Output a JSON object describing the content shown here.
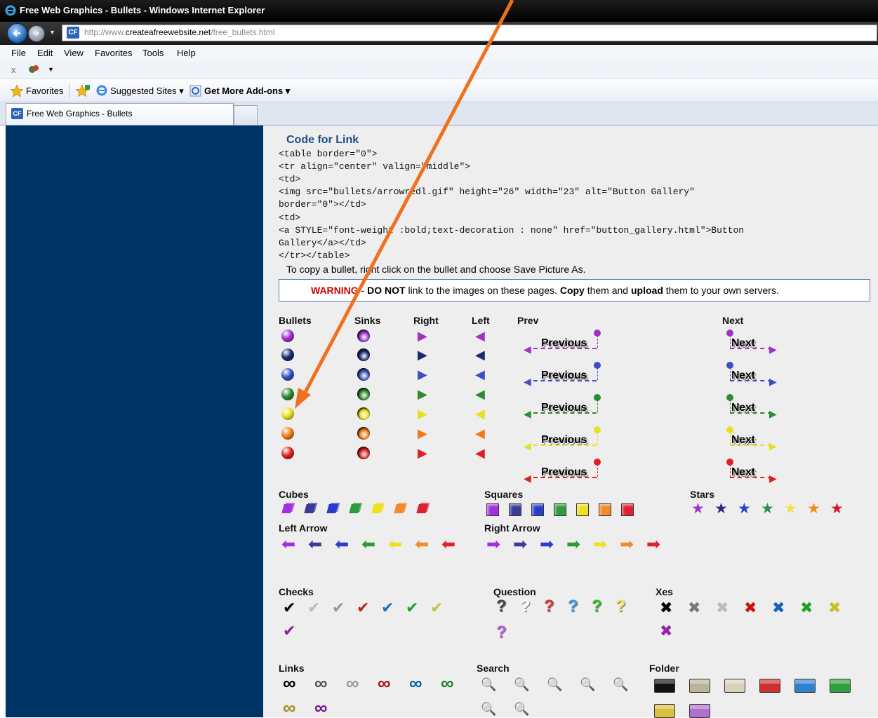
{
  "window": {
    "title": "Free Web Graphics - Bullets - Windows Internet Explorer"
  },
  "address": {
    "prefix": "http://www.",
    "domain": "createafreewebsite.net",
    "path": "/free_bullets.html"
  },
  "menu": [
    "File",
    "Edit",
    "View",
    "Favorites",
    "Tools",
    "Help"
  ],
  "command_bar": {
    "close_glyph": "x"
  },
  "favorites_bar": {
    "favorites": "Favorites",
    "suggested": "Suggested Sites ▾",
    "addons": "Get More Add-ons ▾"
  },
  "tab": {
    "label": "Free Web Graphics - Bullets",
    "icon_text": "CF"
  },
  "page": {
    "code_title": "Code for Link",
    "code_lines": [
      "<table border=\"0\">",
      "<tr align=\"center\" valign=\"middle\">",
      "<td>",
      "<img src=\"bullets/arrowredl.gif\" height=\"26\" width=\"23\" alt=\"Button Gallery\"",
      "border=\"0\"></td>",
      "<td>",
      "<a STYLE=\"font-weight :bold;text-decoration : none\" href=\"button_gallery.html\">Button",
      "Gallery</a></td>",
      "</tr></table>"
    ],
    "copy_note": "To copy a bullet, right click on the bullet and choose Save Picture As.",
    "warning": {
      "label": "WARNING",
      "sep1": " - ",
      "do_not": "DO NOT",
      "mid1": " link to the images on these pages. ",
      "copy": "Copy",
      "mid2": " them and ",
      "upload": "upload",
      "end": " them to your own servers."
    },
    "headers": {
      "bullets": "Bullets",
      "sinks": "Sinks",
      "right": "Right",
      "left": "Left",
      "prev": "Prev",
      "next": "Next",
      "cubes": "Cubes",
      "squares": "Squares",
      "stars": "Stars",
      "left_arrow": "Left Arrow",
      "right_arrow": "Right Arrow",
      "checks": "Checks",
      "question": "Question",
      "xes": "Xes",
      "links": "Links",
      "search": "Search",
      "folder": "Folder"
    },
    "button_labels": {
      "previous": "Previous",
      "next": "Next"
    },
    "glyphs": {
      "right": "▶",
      "left": "◀",
      "star": "★",
      "check": "✔",
      "question": "?",
      "x": "✖",
      "link": "∞",
      "search": "🔍"
    },
    "colors": {
      "bullets": [
        "#a030c8",
        "#1c2a6e",
        "#3b4fc2",
        "#2f8a2f",
        "#e8e020",
        "#f07a1a",
        "#e02020"
      ],
      "cubes": [
        "#a030e0",
        "#3a3a9a",
        "#2a3ad0",
        "#2f9a3a",
        "#f0e020",
        "#f08a2a",
        "#e02030"
      ],
      "stars": [
        "#a030d0",
        "#2a2a80",
        "#2a40d0",
        "#2a9050",
        "#f0e050",
        "#f08a1a",
        "#e01020"
      ],
      "checks": [
        "#000000",
        "#bbbbbb",
        "#999999",
        "#c02020",
        "#2070c0",
        "#20a030",
        "#c8c040",
        "#8a20a0"
      ],
      "questions": [
        "#444444",
        "#ffffff",
        "#e03030",
        "#30a0e0",
        "#30c030",
        "#f0e060",
        "#c060e0"
      ],
      "xes": [
        "#000000",
        "#777777",
        "#bbbbbb",
        "#cc1010",
        "#1060c0",
        "#20a020",
        "#c8c020",
        "#9a20b0"
      ],
      "links": [
        "#000000",
        "#555555",
        "#999999",
        "#aa1010",
        "#1060a0",
        "#208020",
        "#a09020",
        "#7a1090"
      ],
      "search": [
        "#8a8a8a",
        "#b0b0b0",
        "#909090",
        "#a0a0a0",
        "#9a9a9a",
        "#a8a8a8",
        "#b8b8b8"
      ],
      "folders": [
        "#111111",
        "#bcb49a",
        "#d8d2bd",
        "#cc3030",
        "#3080d0",
        "#30a040",
        "#d8c040",
        "#b070d0"
      ],
      "annotation": "#f07020"
    }
  }
}
